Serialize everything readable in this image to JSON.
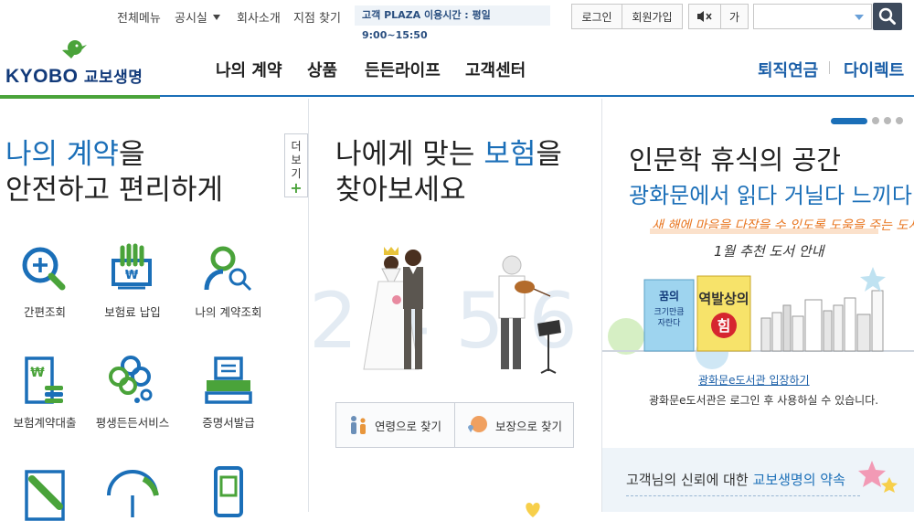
{
  "utility": {
    "links": [
      "전체메뉴",
      "공시실",
      "회사소개",
      "지점 찾기"
    ],
    "hours": "고객 PLAZA 이용시간 : 평일 9:00~15:50",
    "login": "로그인",
    "join": "회원가입",
    "font_size": "가"
  },
  "header": {
    "logo_main": "KYOBO",
    "logo_sub": "교보생명",
    "nav": [
      "나의 계약",
      "상품",
      "든든라이프",
      "고객센터"
    ],
    "nav_right": [
      "퇴직연금",
      "다이렉트"
    ]
  },
  "left": {
    "title_blue": "나의 계약",
    "title_rest": "을",
    "title_line2": "안전하고 편리하게",
    "more_label": "더보기",
    "services": [
      "간편조회",
      "보험료 납입",
      "나의 계약조회",
      "보험계약대출",
      "평생든든서비스",
      "증명서발급"
    ]
  },
  "middle": {
    "title_pre": "나에게 맞는 ",
    "title_blue": "보험",
    "title_post": "을",
    "title_line2": "찾아보세요",
    "bg_numbers": "2 4 5 6",
    "find_age": "연령으로 찾기",
    "find_coverage": "보장으로 찾기"
  },
  "right": {
    "title": "인문학 휴식의 공간",
    "subtitle": "광화문에서 읽다 거닐다 느끼다",
    "hand1": "새 해에 마음을 다잡을 수 있도록 도움을 주는 도서",
    "hand2": "1월 추천 도서 안내",
    "book1": "꿈의 크기만큼 자란다",
    "book2": "역발상의 힘",
    "library_link": "광화문e도서관 입장하기",
    "library_note": "광화문e도서관은 로그인 후 사용하실 수 있습니다.",
    "promise_pre": "고객님의 신뢰에 대한 ",
    "promise_blue": "교보생명의 약속"
  },
  "colors": {
    "brand_blue": "#1b6fb8",
    "brand_green": "#4aa33a",
    "logo_navy": "#123a7a",
    "handwriting_orange": "#e8741d"
  }
}
